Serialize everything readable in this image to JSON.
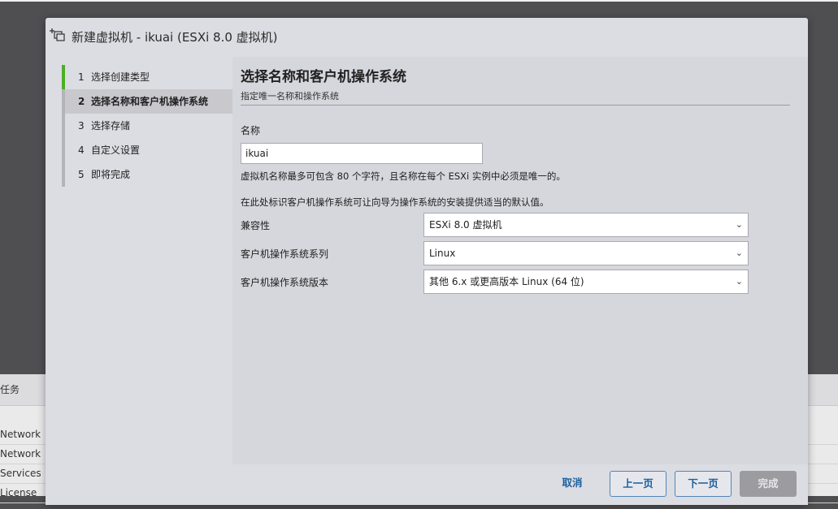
{
  "background": {
    "panel_title": "任务",
    "rows": [
      "Network S",
      "Network C",
      "Services",
      "License"
    ]
  },
  "dialog": {
    "title": "新建虚拟机 - ikuai (ESXi 8.0 虚拟机)",
    "icon": "new-vm-icon"
  },
  "steps": [
    {
      "num": "1",
      "label": "选择创建类型"
    },
    {
      "num": "2",
      "label": "选择名称和客户机操作系统"
    },
    {
      "num": "3",
      "label": "选择存储"
    },
    {
      "num": "4",
      "label": "自定义设置"
    },
    {
      "num": "5",
      "label": "即将完成"
    }
  ],
  "content": {
    "title": "选择名称和客户机操作系统",
    "subtitle": "指定唯一名称和操作系统",
    "name_label": "名称",
    "name_value": "ikuai",
    "name_hint": "虚拟机名称最多可包含 80 个字符，且名称在每个 ESXi 实例中必须是唯一的。",
    "os_hint": "在此处标识客户机操作系统可让向导为操作系统的安装提供适当的默认值。",
    "fields": [
      {
        "label": "兼容性",
        "value": "ESXi 8.0 虚拟机"
      },
      {
        "label": "客户机操作系统系列",
        "value": "Linux"
      },
      {
        "label": "客户机操作系统版本",
        "value": "其他 6.x 或更高版本 Linux (64 位)"
      }
    ]
  },
  "footer": {
    "cancel": "取消",
    "prev": "上一页",
    "next": "下一页",
    "finish": "完成"
  },
  "colors": {
    "accent": "#1a5f9c",
    "step_done": "#4caf24"
  }
}
